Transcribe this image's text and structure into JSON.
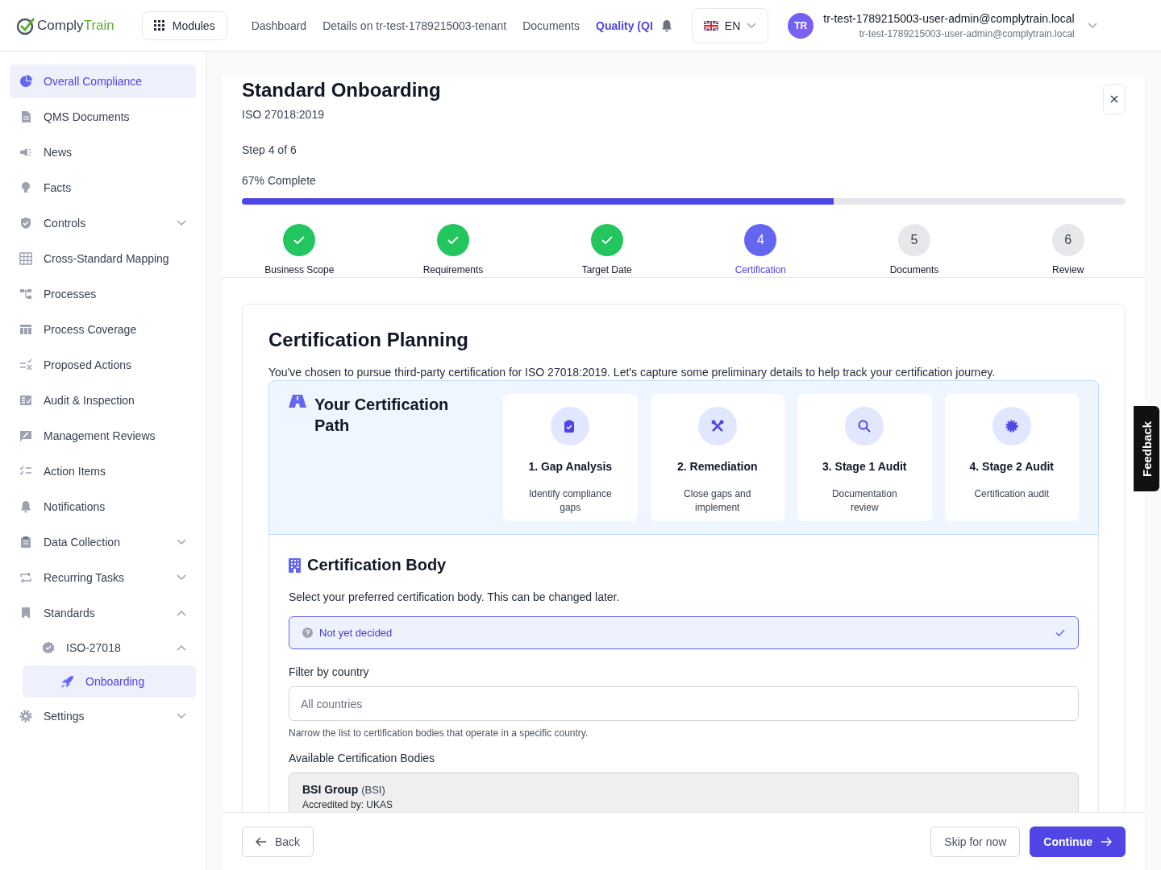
{
  "header": {
    "logo": {
      "part_1": "Comply",
      "part_2": "Train"
    },
    "modules_button": "Modules",
    "nav": [
      {
        "label": "Dashboard",
        "selected": false
      },
      {
        "label": "Details on tr-test-1789215003-tenant",
        "selected": false
      },
      {
        "label": "Documents",
        "selected": false
      },
      {
        "label": "Quality (QI",
        "selected": true
      }
    ],
    "language": "EN",
    "user": {
      "initials": "TR",
      "name": "tr-test-1789215003-user-admin@complytrain.local",
      "email": "tr-test-1789215003-user-admin@complytrain.local"
    }
  },
  "sidebar": {
    "items": [
      {
        "label": "Overall Compliance",
        "selected": true
      },
      {
        "label": "QMS Documents",
        "selected": false
      },
      {
        "label": "News",
        "selected": false
      },
      {
        "label": "Facts",
        "selected": false
      },
      {
        "label": "Controls",
        "selected": false,
        "expanded": false
      },
      {
        "label": "Cross-Standard Mapping",
        "selected": false
      },
      {
        "label": "Processes",
        "selected": false
      },
      {
        "label": "Process Coverage",
        "selected": false
      },
      {
        "label": "Proposed Actions",
        "selected": false
      },
      {
        "label": "Audit & Inspection",
        "selected": false
      },
      {
        "label": "Management Reviews",
        "selected": false
      },
      {
        "label": "Action Items",
        "selected": false
      },
      {
        "label": "Notifications",
        "selected": false
      },
      {
        "label": "Data Collection",
        "selected": false,
        "expanded": false
      },
      {
        "label": "Recurring Tasks",
        "selected": false,
        "expanded": false
      },
      {
        "label": "Standards",
        "selected": false,
        "expanded": true,
        "children": [
          {
            "label": "ISO-27018",
            "selected": false,
            "expanded": true,
            "children": [
              {
                "label": "Onboarding",
                "selected": true
              }
            ]
          }
        ]
      },
      {
        "label": "Settings",
        "selected": false,
        "expanded": false
      }
    ]
  },
  "onboarding": {
    "title": "Standard Onboarding",
    "standard": "ISO 27018:2019",
    "step_label": "Step 4 of 6",
    "progress_label": "67% Complete",
    "progress": {
      "level": 0.67
    },
    "steps": [
      {
        "label": "Business Scope",
        "completed": true,
        "selected": false
      },
      {
        "label": "Requirements",
        "completed": true,
        "selected": false
      },
      {
        "label": "Target Date",
        "completed": true,
        "selected": false
      },
      {
        "number": "4",
        "label": "Certification",
        "completed": false,
        "selected": true
      },
      {
        "number": "5",
        "label": "Documents",
        "completed": false,
        "selected": false
      },
      {
        "number": "6",
        "label": "Review",
        "completed": false,
        "selected": false
      }
    ]
  },
  "certification_planning": {
    "title": "Certification Planning",
    "intro": "You've chosen to pursue third-party certification for ISO 27018:2019. Let's capture some preliminary details to help track your certification journey.",
    "path": {
      "title": "Your Certification Path",
      "stages": [
        {
          "title": "1. Gap Analysis",
          "description": "Identify compliance gaps"
        },
        {
          "title": "2. Remediation",
          "description": "Close gaps and implement"
        },
        {
          "title": "3. Stage 1 Audit",
          "description": "Documentation review"
        },
        {
          "title": "4. Stage 2 Audit",
          "description": "Certification audit"
        }
      ]
    },
    "body_section": {
      "title": "Certification Body",
      "hint": "Select your preferred certification body. This can be changed later.",
      "selected_body": {
        "value": "Not yet decided"
      },
      "filter": {
        "label": "Filter by country",
        "placeholder": "All countries",
        "help": "Narrow the list to certification bodies that operate in a specific country."
      },
      "available_label": "Available Certification Bodies",
      "bodies": [
        {
          "name": "BSI Group",
          "abbreviation": "(BSI)",
          "accreditation": "Accredited by: UKAS"
        }
      ]
    }
  },
  "footer": {
    "back": "Back",
    "skip": "Skip for now",
    "continue": "Continue"
  },
  "feedback_tab": "Feedback"
}
